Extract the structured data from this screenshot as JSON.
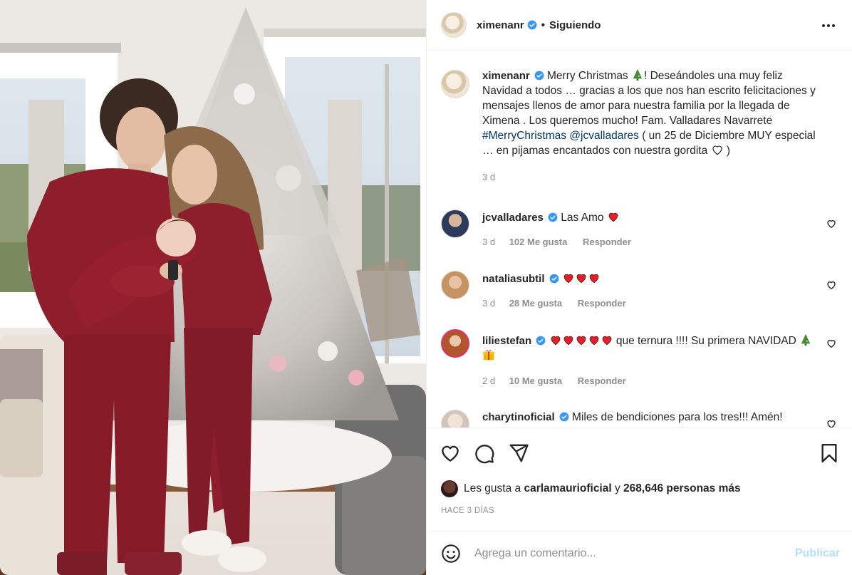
{
  "header": {
    "username": "ximenanr",
    "separator": "•",
    "follow_state": "Siguiendo"
  },
  "caption": {
    "username": "ximenanr",
    "text_1": "Merry Christmas",
    "text_2": "! Deseándoles una muy feliz Navidad a todos … gracias a los que nos han escrito felicitaciones y mensajes llenos de amor para nuestra familia por la llegada de Ximena . Los queremos mucho! Fam. Valladares Navarrete",
    "hashtag": "#MerryChristmas",
    "mention": "@jcvalladares",
    "text_3": "( un 25 de Diciembre MUY especial … en pijamas encantados con nuestra gordita",
    "text_4": ")",
    "time": "3 d"
  },
  "comments": [
    {
      "username": "jcvalladares",
      "text": "Las Amo",
      "hearts": 1,
      "time": "3 d",
      "likes": "102 Me gusta",
      "reply": "Responder"
    },
    {
      "username": "nataliasubtil",
      "text": "",
      "hearts": 3,
      "time": "3 d",
      "likes": "28 Me gusta",
      "reply": "Responder"
    },
    {
      "username": "liliestefan",
      "text_a": "que ternura !!!! Su primera",
      "text_b": "NAVIDAD",
      "hearts": 5,
      "time": "2 d",
      "likes": "10 Me gusta",
      "reply": "Responder"
    },
    {
      "username": "charytinoficial",
      "text": "Miles de bendiciones para los tres!!! Amén!"
    }
  ],
  "likes": {
    "prefix": "Les gusta a",
    "user": "carlamaurioficial",
    "connector": "y",
    "count": "268,646 personas más"
  },
  "timestamp": "HACE 3 DÍAS",
  "comment_input": {
    "placeholder": "Agrega un comentario...",
    "publish": "Publicar"
  },
  "colors": {
    "verified": "#3897f0",
    "heart_red": "#ed1c24",
    "link": "#00376b",
    "muted": "#8e8e8e",
    "publish_disabled": "#b2dffc"
  },
  "icons": [
    "verified-badge-icon",
    "more-options-icon",
    "heart-icon",
    "comment-icon",
    "share-icon",
    "bookmark-icon",
    "emoji-icon",
    "christmas-tree-emoji",
    "gift-emoji"
  ]
}
